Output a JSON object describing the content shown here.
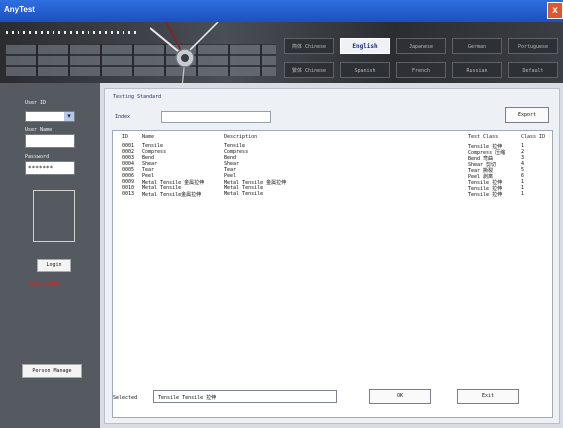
{
  "window": {
    "title": "AnyTest",
    "close_glyph": "x"
  },
  "languages": {
    "row1": [
      "简体 Chinese",
      "English",
      "Japanese",
      "German",
      "Portuguese"
    ],
    "row2": [
      "繁体 Chinese",
      "Spanish",
      "French",
      "Russian",
      "Default"
    ],
    "selected": "English"
  },
  "left_panel": {
    "user_id_label": "User ID",
    "user_name_label": "User Name",
    "password_label": "Password",
    "password_value": "*******",
    "login_button": "Login",
    "login_status": "Please Login",
    "person_manage_button": "Person Manage"
  },
  "main": {
    "section_title": "Testing Standard",
    "index_label": "Index",
    "export_button": "Export",
    "table": {
      "columns": [
        "ID",
        "Name",
        "Description",
        "Test Class",
        "Class ID"
      ],
      "rows": [
        [
          "0001",
          "Tensile",
          "Tensile",
          "Tensile 拉伸",
          "1"
        ],
        [
          "0002",
          "Compress",
          "Compress",
          "Compress 压缩",
          "2"
        ],
        [
          "0003",
          "Bend",
          "Bend",
          "Bend 弯曲",
          "3"
        ],
        [
          "0004",
          "Shear",
          "Shear",
          "Shear 剪切",
          "4"
        ],
        [
          "0005",
          "Tear",
          "Tear",
          "Tear 撕裂",
          "5"
        ],
        [
          "0006",
          "Peel",
          "Peel",
          "Peel 剥离",
          "6"
        ],
        [
          "0009",
          "Metal Tensile 金属拉伸",
          "Metal Tensile 金属拉伸",
          "Tensile 拉伸",
          "1"
        ],
        [
          "0010",
          "Metal Tensile",
          "Metal Tensile",
          "Tensile 拉伸",
          "1"
        ],
        [
          "0013",
          "Metal Tensile金属拉伸",
          "Metal Tensile",
          "Tensile 拉伸",
          "1"
        ]
      ]
    },
    "selected_label": "Selected",
    "selected_value": "Tensile  Tensile 拉伸",
    "ok_button": "OK",
    "exit_button": "Exit"
  },
  "colors": {
    "title_bar": "#2f6fe0",
    "accent_red": "#d8221f",
    "left_panel": "#555a61"
  }
}
